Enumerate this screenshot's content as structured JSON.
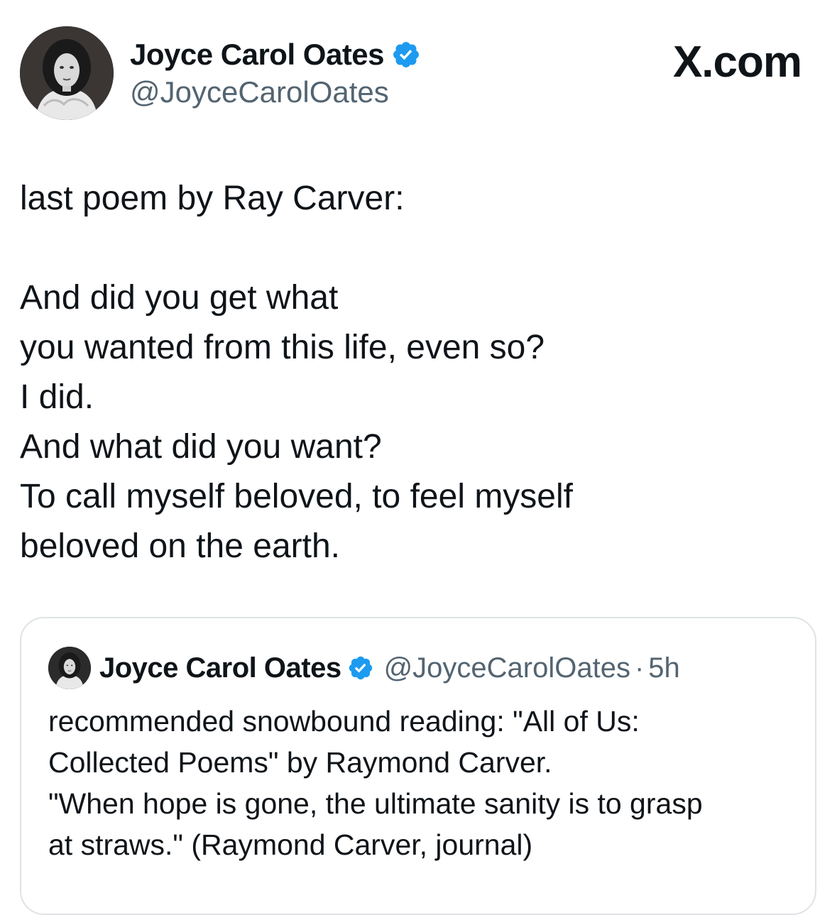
{
  "tweet": {
    "author_name": "Joyce Carol Oates",
    "author_handle": "@JoyceCarolOates",
    "avatar_icon": "author-portrait",
    "verified_icon": "verified-badge-icon",
    "lines": [
      "last poem by Ray Carver:",
      "",
      "And did you get what",
      "you wanted from this life, even so?",
      "I did.",
      "And what did you want?",
      "To call myself beloved, to feel myself",
      "beloved on the earth."
    ]
  },
  "brand": {
    "label": "X.com"
  },
  "quoted_tweet": {
    "author_name": "Joyce Carol Oates",
    "author_handle": "@JoyceCarolOates",
    "separator": "·",
    "time": "5h",
    "lines": [
      "recommended snowbound reading:  \"All of Us:",
      "Collected Poems\" by Raymond Carver.",
      "\"When hope is gone, the ultimate sanity is to grasp",
      "at straws.\"  (Raymond Carver, journal)"
    ]
  },
  "colors": {
    "verified_blue": "#1d9bf0",
    "secondary_text": "#536471",
    "primary_text": "#0f1419",
    "card_border": "#dfe3e6"
  }
}
